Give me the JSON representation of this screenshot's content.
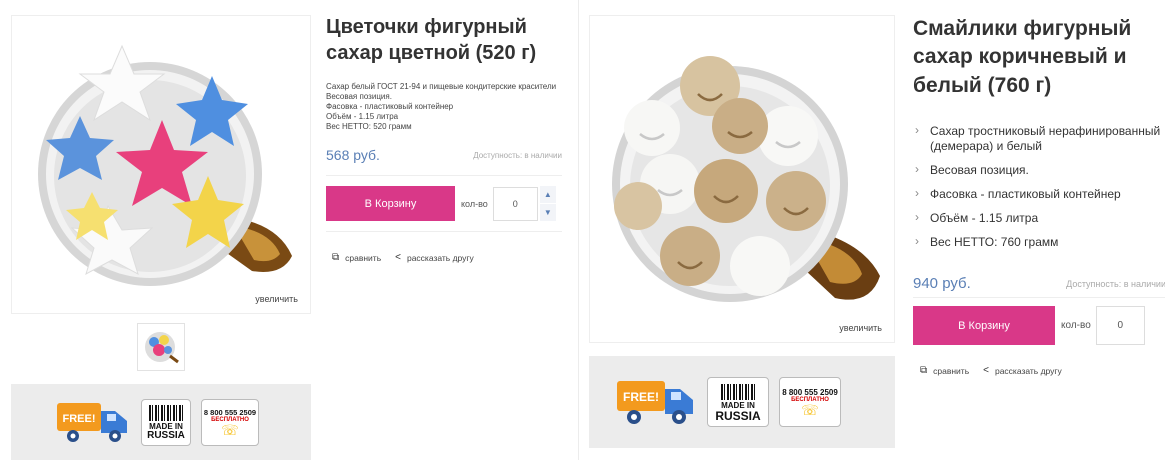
{
  "products": [
    {
      "title": "Цветочки фигурный сахар цветной (520 г)",
      "zoom_label": "увеличить",
      "image_icon": "flower-sugar-cup-image",
      "thumb_icon": "flower-sugar-thumbnail-icon",
      "description": [
        "Сахар белый ГОСТ 21-94 и пищевые кондитерские красители",
        "Весовая позиция.",
        "Фасовка - пластиковый контейнер",
        "Объём - 1.15 литра",
        "Вес НЕТТО: 520 грамм"
      ],
      "price": "568 руб.",
      "availability": "Доступность: в наличии",
      "cart_label": "В Корзину",
      "qty_label": "кол-во",
      "qty_value": "0",
      "compare_label": "сравнить",
      "share_label": "рассказать другу"
    },
    {
      "title": "Смайлики фигурный сахар коричневый и белый (760 г)",
      "zoom_label": "увеличить",
      "image_icon": "smiley-sugar-cup-image",
      "bullets": [
        "Сахар тростниковый нерафинированный (демерара) и белый",
        "Весовая позиция.",
        "Фасовка - пластиковый контейнер",
        "Объём - 1.15 литра",
        "Вес НЕТТО: 760 грамм"
      ],
      "price": "940 руб.",
      "availability": "Доступность: в наличии",
      "cart_label": "В Корзину",
      "qty_label": "кол-во",
      "qty_value": "0",
      "compare_label": "сравнить",
      "share_label": "рассказать другу"
    }
  ],
  "badges": {
    "free_label": "FREE!",
    "made_line1": "MADE IN",
    "made_line2": "RUSSIA",
    "phone_number": "8 800 555 2509",
    "phone_free": "БЕСПЛАТНО"
  },
  "colors": {
    "accent_pink": "#d93888",
    "price_blue": "#5a7fb5",
    "badge_bar_bg": "#ececec"
  }
}
